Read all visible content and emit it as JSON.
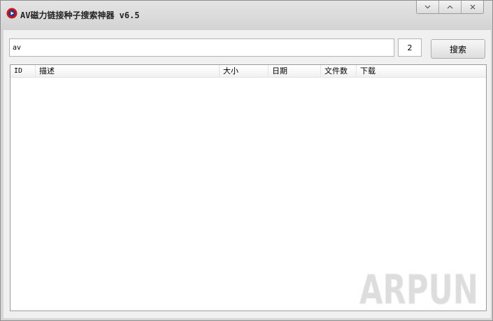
{
  "window": {
    "title": "AV磁力链接种子搜索神器 v6.5",
    "controls": [
      "chevron-down-icon",
      "chevron-up-icon",
      "close-icon"
    ]
  },
  "search": {
    "query": "av",
    "page": "2",
    "button_label": "搜索"
  },
  "results": {
    "columns": [
      "ID",
      "描述",
      "大小",
      "日期",
      "文件数",
      "下载"
    ],
    "rows": []
  },
  "watermark": {
    "text": "ARPUN"
  },
  "colors": {
    "accent": "#c9161c",
    "icon_blue": "#1d3a8a",
    "client_bg": "#f0f0f0",
    "titlebar_bg": "#d6d6d6"
  }
}
